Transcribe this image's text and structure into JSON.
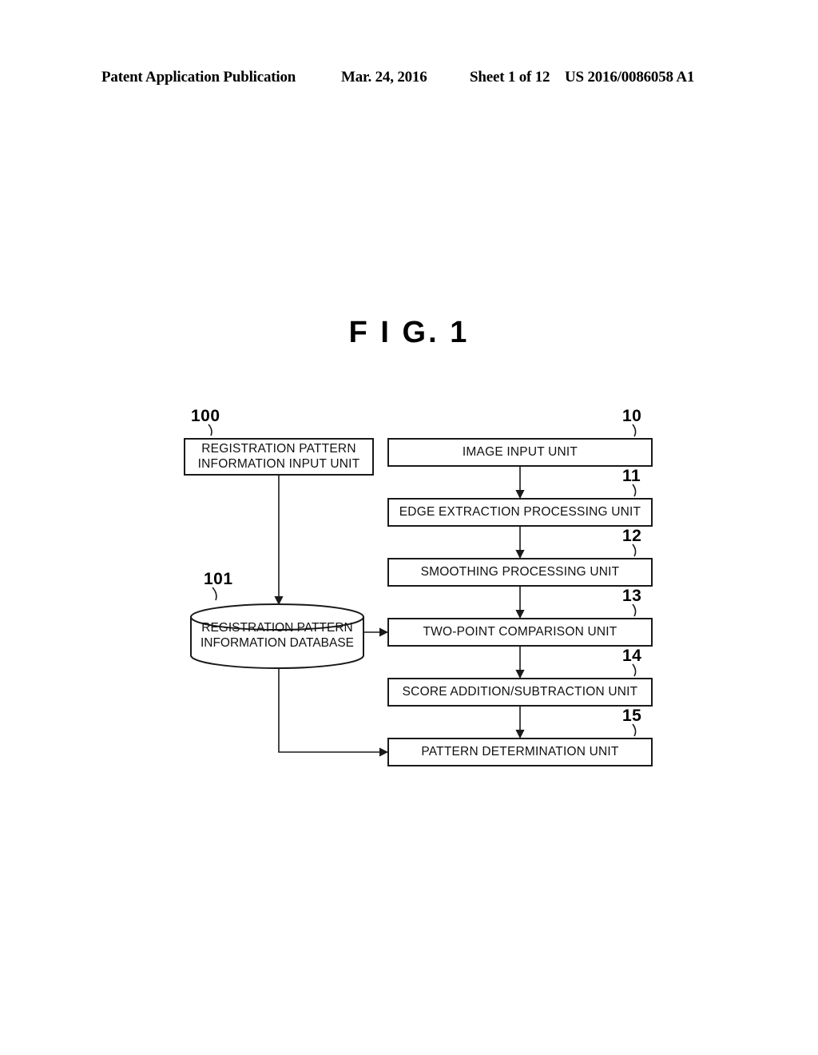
{
  "header": {
    "publication": "Patent Application Publication",
    "date": "Mar. 24, 2016",
    "sheet": "Sheet 1 of 12",
    "patent_number": "US 2016/0086058 A1"
  },
  "figure": {
    "title": "F I G.  1"
  },
  "diagram": {
    "left_column": {
      "input_unit": {
        "ref": "100",
        "line1": "REGISTRATION PATTERN",
        "line2": "INFORMATION INPUT UNIT"
      },
      "database": {
        "ref": "101",
        "line1": "REGISTRATION PATTERN",
        "line2": "INFORMATION DATABASE"
      }
    },
    "pipeline": [
      {
        "ref": "10",
        "label": "IMAGE INPUT UNIT"
      },
      {
        "ref": "11",
        "label": "EDGE EXTRACTION PROCESSING UNIT"
      },
      {
        "ref": "12",
        "label": "SMOOTHING PROCESSING UNIT"
      },
      {
        "ref": "13",
        "label": "TWO-POINT COMPARISON UNIT"
      },
      {
        "ref": "14",
        "label": "SCORE ADDITION/SUBTRACTION UNIT"
      },
      {
        "ref": "15",
        "label": "PATTERN DETERMINATION UNIT"
      }
    ],
    "colors": {
      "stroke": "#1a1a1a",
      "background": "#ffffff",
      "text": "#111111"
    }
  }
}
